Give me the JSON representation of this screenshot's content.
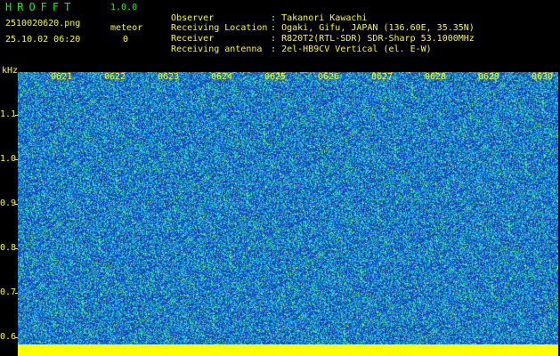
{
  "header": {
    "title": "HROFFT",
    "version": "1.0.0",
    "filename": "2510020620.png",
    "meteor_label": "meteor",
    "datetime": "25.10.02 06:20",
    "meteor_count": "0"
  },
  "info": [
    {
      "label": "Observer",
      "value": ": Takanori Kawachi"
    },
    {
      "label": "Receiving Location",
      "value": ": Ogaki, Gifu, JAPAN (136.60E, 35.35N)"
    },
    {
      "label": "Receiver",
      "value": ": R820T2(RTL-SDR) SDR-Sharp 53.1000MHz"
    },
    {
      "label": "Receiving antenna",
      "value": ": 2el-HB9CV Vertical (el. E-W)"
    }
  ],
  "plot": {
    "y_unit": "kHz",
    "y_ticks": [
      "1.1",
      "1.0",
      "0.9",
      "0.8",
      "0.7",
      "0.6"
    ],
    "x_ticks": [
      "0621",
      "0622",
      "0623",
      "0624",
      "0625",
      "0626",
      "0627",
      "0628",
      "0629",
      "0630"
    ],
    "colors": {
      "background": "#000000",
      "label_text": "#ffff00",
      "title_text": "#00ff00",
      "noise_dark": "#1a3db8",
      "noise_mid": "#0f8bd9",
      "noise_light": "#27d3c7",
      "noise_peak": "#7cf06a",
      "baseline": "#ffff00"
    }
  }
}
